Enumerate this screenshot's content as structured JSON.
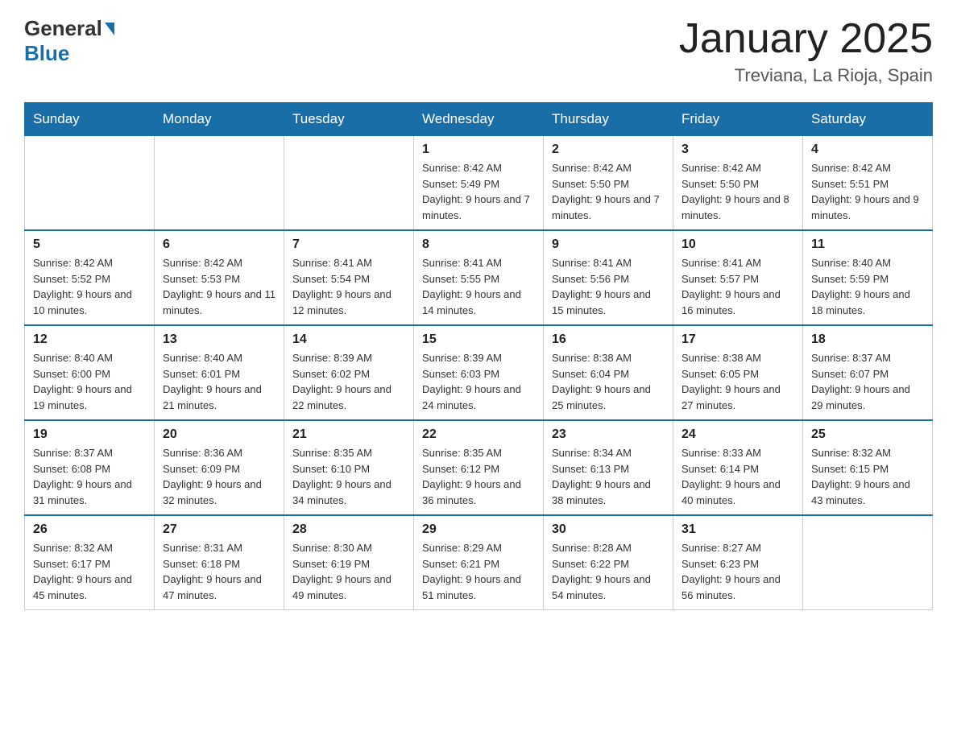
{
  "header": {
    "logo_general": "General",
    "logo_blue": "Blue",
    "month_title": "January 2025",
    "location": "Treviana, La Rioja, Spain"
  },
  "days_of_week": [
    "Sunday",
    "Monday",
    "Tuesday",
    "Wednesday",
    "Thursday",
    "Friday",
    "Saturday"
  ],
  "weeks": [
    [
      {
        "day": "",
        "detail": ""
      },
      {
        "day": "",
        "detail": ""
      },
      {
        "day": "",
        "detail": ""
      },
      {
        "day": "1",
        "detail": "Sunrise: 8:42 AM\nSunset: 5:49 PM\nDaylight: 9 hours and 7 minutes."
      },
      {
        "day": "2",
        "detail": "Sunrise: 8:42 AM\nSunset: 5:50 PM\nDaylight: 9 hours and 7 minutes."
      },
      {
        "day": "3",
        "detail": "Sunrise: 8:42 AM\nSunset: 5:50 PM\nDaylight: 9 hours and 8 minutes."
      },
      {
        "day": "4",
        "detail": "Sunrise: 8:42 AM\nSunset: 5:51 PM\nDaylight: 9 hours and 9 minutes."
      }
    ],
    [
      {
        "day": "5",
        "detail": "Sunrise: 8:42 AM\nSunset: 5:52 PM\nDaylight: 9 hours and 10 minutes."
      },
      {
        "day": "6",
        "detail": "Sunrise: 8:42 AM\nSunset: 5:53 PM\nDaylight: 9 hours and 11 minutes."
      },
      {
        "day": "7",
        "detail": "Sunrise: 8:41 AM\nSunset: 5:54 PM\nDaylight: 9 hours and 12 minutes."
      },
      {
        "day": "8",
        "detail": "Sunrise: 8:41 AM\nSunset: 5:55 PM\nDaylight: 9 hours and 14 minutes."
      },
      {
        "day": "9",
        "detail": "Sunrise: 8:41 AM\nSunset: 5:56 PM\nDaylight: 9 hours and 15 minutes."
      },
      {
        "day": "10",
        "detail": "Sunrise: 8:41 AM\nSunset: 5:57 PM\nDaylight: 9 hours and 16 minutes."
      },
      {
        "day": "11",
        "detail": "Sunrise: 8:40 AM\nSunset: 5:59 PM\nDaylight: 9 hours and 18 minutes."
      }
    ],
    [
      {
        "day": "12",
        "detail": "Sunrise: 8:40 AM\nSunset: 6:00 PM\nDaylight: 9 hours and 19 minutes."
      },
      {
        "day": "13",
        "detail": "Sunrise: 8:40 AM\nSunset: 6:01 PM\nDaylight: 9 hours and 21 minutes."
      },
      {
        "day": "14",
        "detail": "Sunrise: 8:39 AM\nSunset: 6:02 PM\nDaylight: 9 hours and 22 minutes."
      },
      {
        "day": "15",
        "detail": "Sunrise: 8:39 AM\nSunset: 6:03 PM\nDaylight: 9 hours and 24 minutes."
      },
      {
        "day": "16",
        "detail": "Sunrise: 8:38 AM\nSunset: 6:04 PM\nDaylight: 9 hours and 25 minutes."
      },
      {
        "day": "17",
        "detail": "Sunrise: 8:38 AM\nSunset: 6:05 PM\nDaylight: 9 hours and 27 minutes."
      },
      {
        "day": "18",
        "detail": "Sunrise: 8:37 AM\nSunset: 6:07 PM\nDaylight: 9 hours and 29 minutes."
      }
    ],
    [
      {
        "day": "19",
        "detail": "Sunrise: 8:37 AM\nSunset: 6:08 PM\nDaylight: 9 hours and 31 minutes."
      },
      {
        "day": "20",
        "detail": "Sunrise: 8:36 AM\nSunset: 6:09 PM\nDaylight: 9 hours and 32 minutes."
      },
      {
        "day": "21",
        "detail": "Sunrise: 8:35 AM\nSunset: 6:10 PM\nDaylight: 9 hours and 34 minutes."
      },
      {
        "day": "22",
        "detail": "Sunrise: 8:35 AM\nSunset: 6:12 PM\nDaylight: 9 hours and 36 minutes."
      },
      {
        "day": "23",
        "detail": "Sunrise: 8:34 AM\nSunset: 6:13 PM\nDaylight: 9 hours and 38 minutes."
      },
      {
        "day": "24",
        "detail": "Sunrise: 8:33 AM\nSunset: 6:14 PM\nDaylight: 9 hours and 40 minutes."
      },
      {
        "day": "25",
        "detail": "Sunrise: 8:32 AM\nSunset: 6:15 PM\nDaylight: 9 hours and 43 minutes."
      }
    ],
    [
      {
        "day": "26",
        "detail": "Sunrise: 8:32 AM\nSunset: 6:17 PM\nDaylight: 9 hours and 45 minutes."
      },
      {
        "day": "27",
        "detail": "Sunrise: 8:31 AM\nSunset: 6:18 PM\nDaylight: 9 hours and 47 minutes."
      },
      {
        "day": "28",
        "detail": "Sunrise: 8:30 AM\nSunset: 6:19 PM\nDaylight: 9 hours and 49 minutes."
      },
      {
        "day": "29",
        "detail": "Sunrise: 8:29 AM\nSunset: 6:21 PM\nDaylight: 9 hours and 51 minutes."
      },
      {
        "day": "30",
        "detail": "Sunrise: 8:28 AM\nSunset: 6:22 PM\nDaylight: 9 hours and 54 minutes."
      },
      {
        "day": "31",
        "detail": "Sunrise: 8:27 AM\nSunset: 6:23 PM\nDaylight: 9 hours and 56 minutes."
      },
      {
        "day": "",
        "detail": ""
      }
    ]
  ]
}
